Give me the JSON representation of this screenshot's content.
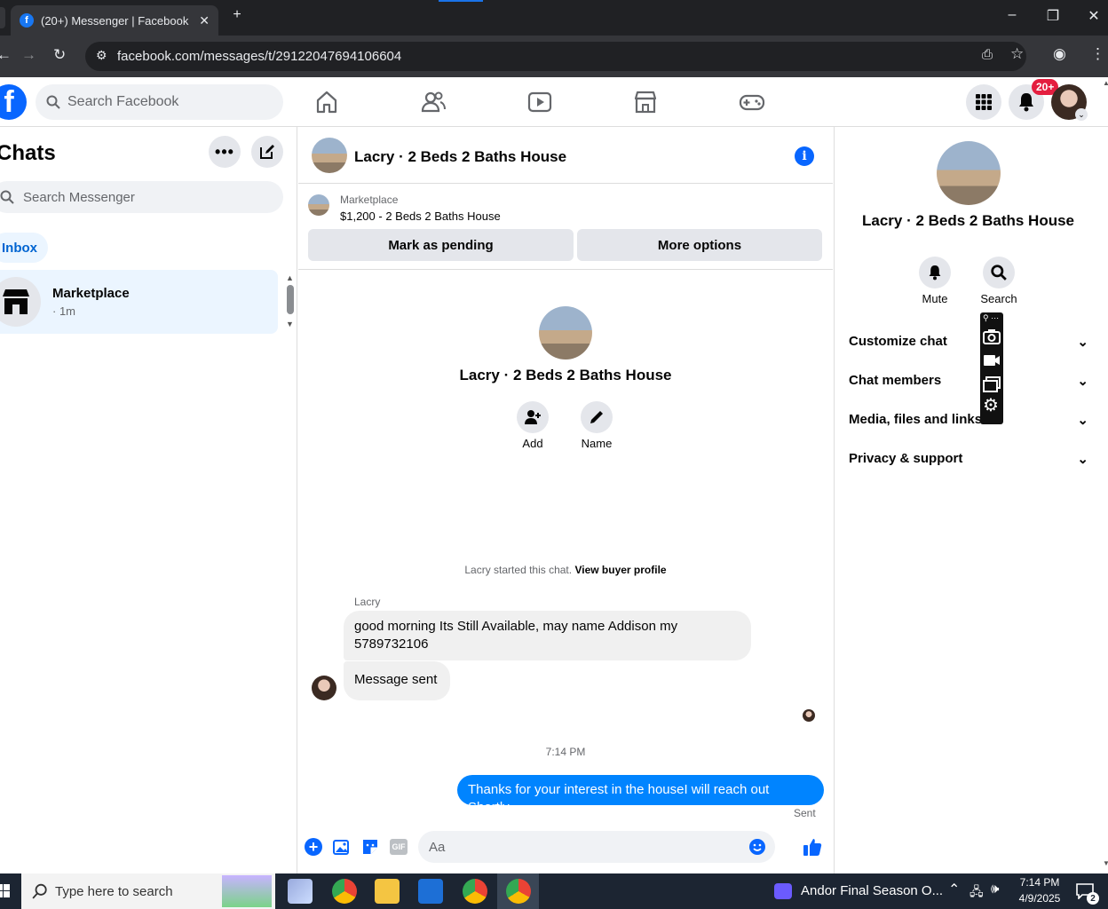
{
  "browser": {
    "tab_title": "(20+) Messenger | Facebook",
    "url": "facebook.com/messages/t/29122047694106604"
  },
  "header": {
    "search_placeholder": "Search Facebook",
    "notif_badge": "20+"
  },
  "left": {
    "title": "Chats",
    "search_placeholder": "Search Messenger",
    "inbox_label": "Inbox",
    "chat_name": "Marketplace",
    "chat_time": "· 1m"
  },
  "conversation": {
    "title": "Lacry · 2 Beds 2 Baths House",
    "listing_source": "Marketplace",
    "listing_text": "$1,200 - 2 Beds 2 Baths House",
    "mark_pending": "Mark as pending",
    "more_options": "More options",
    "profile_name": "Lacry · 2 Beds 2 Baths House",
    "add_label": "Add",
    "name_label": "Name",
    "started_text": "Lacry started this chat.",
    "view_profile": "View buyer profile",
    "sender_name": "Lacry",
    "msg1": "good morning  Its Still Available, may name Addison my 5789732106",
    "msg2": "Message sent",
    "time_divider": "7:14 PM",
    "msg3": "Thanks for your interest in the houseI will reach out Shortly",
    "sent_status": "Sent",
    "compose_placeholder": "Aa"
  },
  "details": {
    "name": "Lacry · 2 Beds 2 Baths House",
    "mute": "Mute",
    "search": "Search",
    "sections": [
      "Customize chat",
      "Chat members",
      "Media, files and links",
      "Privacy & support"
    ]
  },
  "taskbar": {
    "search_placeholder": "Type here to search",
    "media_title": "Andor Final Season O...",
    "time": "7:14 PM",
    "date": "4/9/2025",
    "notif_count": "2"
  },
  "colors": {
    "fb_blue": "#0866ff",
    "bubble_blue": "#0084ff",
    "bubble_gray": "#f0f0f0"
  }
}
